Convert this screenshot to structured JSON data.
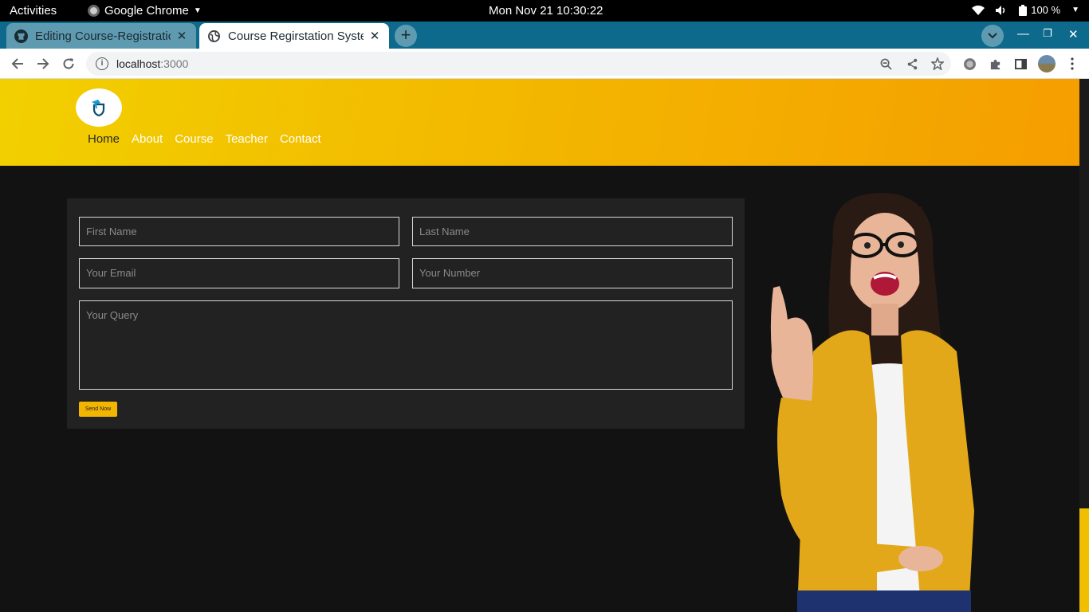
{
  "os_bar": {
    "activities": "Activities",
    "app_name": "Google Chrome",
    "clock": "Mon Nov 21  10:30:22",
    "battery": "100 %"
  },
  "browser": {
    "tabs": [
      {
        "title": "Editing Course-Registratio",
        "icon": "github-icon"
      },
      {
        "title": "Course Regirstation Syste",
        "icon": "globe-icon"
      }
    ],
    "url_host": "localhost",
    "url_port": ":3000"
  },
  "site": {
    "nav": [
      {
        "label": "Home",
        "active": true
      },
      {
        "label": "About"
      },
      {
        "label": "Course"
      },
      {
        "label": "Teacher"
      },
      {
        "label": "Contact"
      }
    ],
    "form": {
      "first_name_placeholder": "First Name",
      "last_name_placeholder": "Last Name",
      "email_placeholder": "Your Email",
      "number_placeholder": "Your Number",
      "query_placeholder": "Your Query",
      "send_label": "Send Now"
    }
  },
  "colors": {
    "brand_yellow": "#f3b600",
    "page_bg": "#121212",
    "card_bg": "#222222",
    "tab_strip": "#0e6a8c"
  }
}
